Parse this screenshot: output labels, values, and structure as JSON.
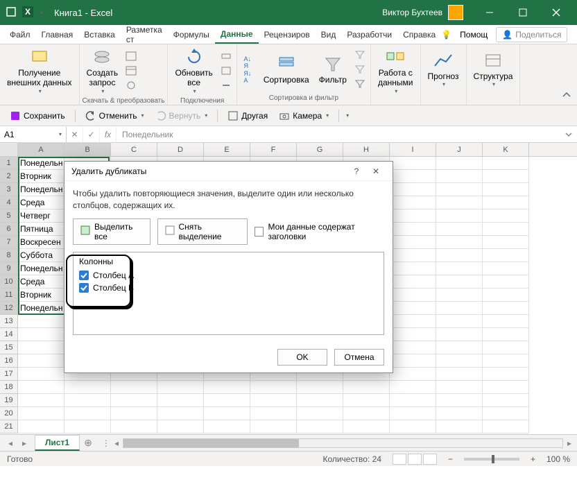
{
  "titlebar": {
    "title": "Книга1 - Excel",
    "user": "Виктор Бухтеев"
  },
  "tabs": {
    "file": "Файл",
    "home": "Главная",
    "insert": "Вставка",
    "layout": "Разметка ст",
    "formulas": "Формулы",
    "data": "Данные",
    "review": "Рецензиров",
    "view": "Вид",
    "dev": "Разработчи",
    "help": "Справка",
    "assist": "Помощ",
    "share": "Поделиться"
  },
  "ribbon": {
    "ext_data": "Получение\nвнешних данных",
    "ext_data_grp": "",
    "query": "Создать\nзапрос",
    "query_grp": "Скачать & преобразовать",
    "refresh": "Обновить\nвсе",
    "conn_grp": "Подключения",
    "sort": "Сортировка",
    "filter": "Фильтр",
    "sort_grp": "Сортировка и фильтр",
    "data_tools": "Работа с\nданными",
    "forecast": "Прогноз",
    "structure": "Структура"
  },
  "qat": {
    "save": "Сохранить",
    "undo": "Отменить",
    "redo": "Вернуть",
    "other": "Другая",
    "camera": "Камера"
  },
  "namebox": "A1",
  "formula": "Понедельник",
  "columns": [
    "A",
    "B",
    "C",
    "D",
    "E",
    "F",
    "G",
    "H",
    "I",
    "J",
    "K"
  ],
  "rows": [
    {
      "n": 1,
      "a": "Понедельн"
    },
    {
      "n": 2,
      "a": "Вторник"
    },
    {
      "n": 3,
      "a": "Понедельн"
    },
    {
      "n": 4,
      "a": "Среда"
    },
    {
      "n": 5,
      "a": "Четверг"
    },
    {
      "n": 6,
      "a": "Пятница"
    },
    {
      "n": 7,
      "a": "Воскресен"
    },
    {
      "n": 8,
      "a": "Суббота"
    },
    {
      "n": 9,
      "a": "Понедельн"
    },
    {
      "n": 10,
      "a": "Среда"
    },
    {
      "n": 11,
      "a": "Вторник"
    },
    {
      "n": 12,
      "a": "Понедельн"
    },
    {
      "n": 13,
      "a": ""
    },
    {
      "n": 14,
      "a": ""
    },
    {
      "n": 15,
      "a": ""
    },
    {
      "n": 16,
      "a": ""
    },
    {
      "n": 17,
      "a": ""
    },
    {
      "n": 18,
      "a": ""
    },
    {
      "n": 19,
      "a": ""
    },
    {
      "n": 20,
      "a": ""
    },
    {
      "n": 21,
      "a": ""
    }
  ],
  "sheet": "Лист1",
  "status": {
    "ready": "Готово",
    "count_label": "Количество:",
    "count": "24",
    "zoom": "100 %"
  },
  "dialog": {
    "title": "Удалить дубликаты",
    "desc": "Чтобы удалить повторяющиеся значения, выделите один или несколько столбцов, содержащих их.",
    "select_all": "Выделить все",
    "deselect_all": "Снять выделение",
    "has_headers": "Мои данные содержат заголовки",
    "cols_label": "Колонны",
    "col_a": "Столбец A",
    "col_b": "Столбец B",
    "ok": "OK",
    "cancel": "Отмена"
  }
}
